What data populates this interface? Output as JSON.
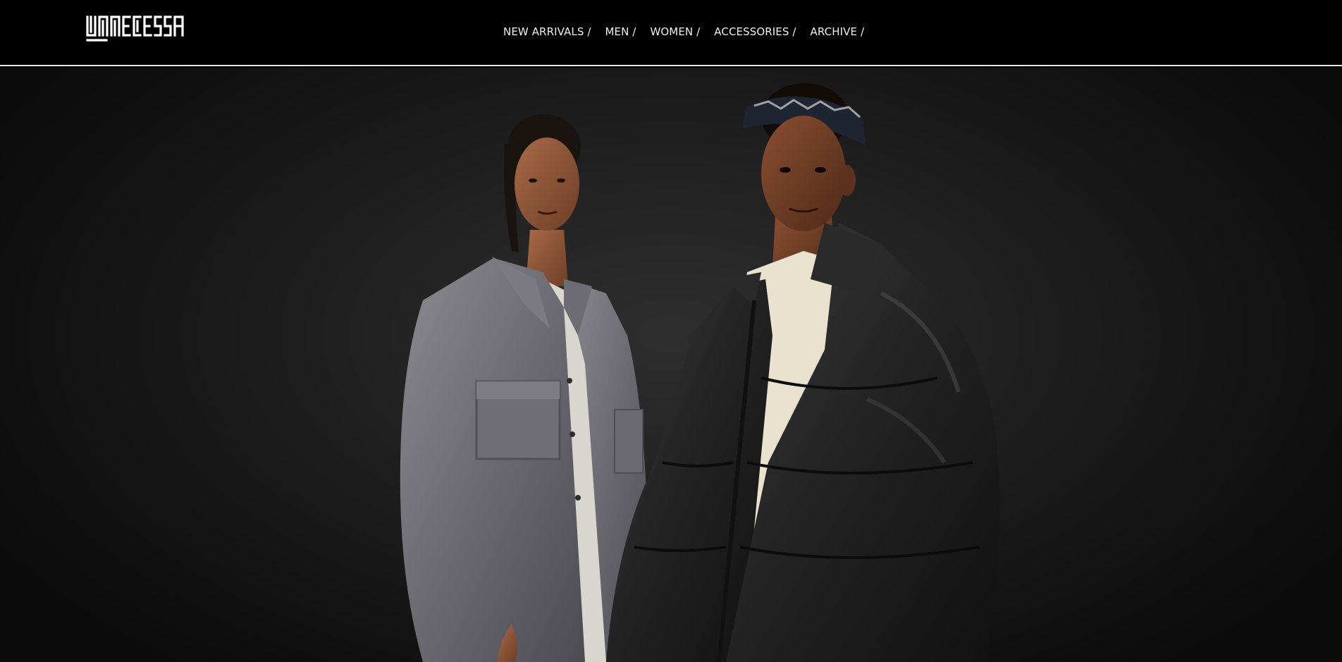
{
  "brand": {
    "name": "UNNECESSARY"
  },
  "nav": {
    "items": [
      {
        "label": "NEW ARRIVALS /"
      },
      {
        "label": "MEN /"
      },
      {
        "label": "WOMEN /"
      },
      {
        "label": "ACCESSORIES /"
      },
      {
        "label": "ARCHIVE /"
      }
    ]
  },
  "hero": {
    "image": "hero-campaign-photo",
    "subjects": [
      "model-woman-grey-overshirt",
      "model-man-black-puffer-jacket"
    ]
  },
  "colors": {
    "header_bg": "#000000",
    "nav_text": "#f0f0f0",
    "divider": "#e6e6e6",
    "hero_bg": "#1a1a1a"
  }
}
